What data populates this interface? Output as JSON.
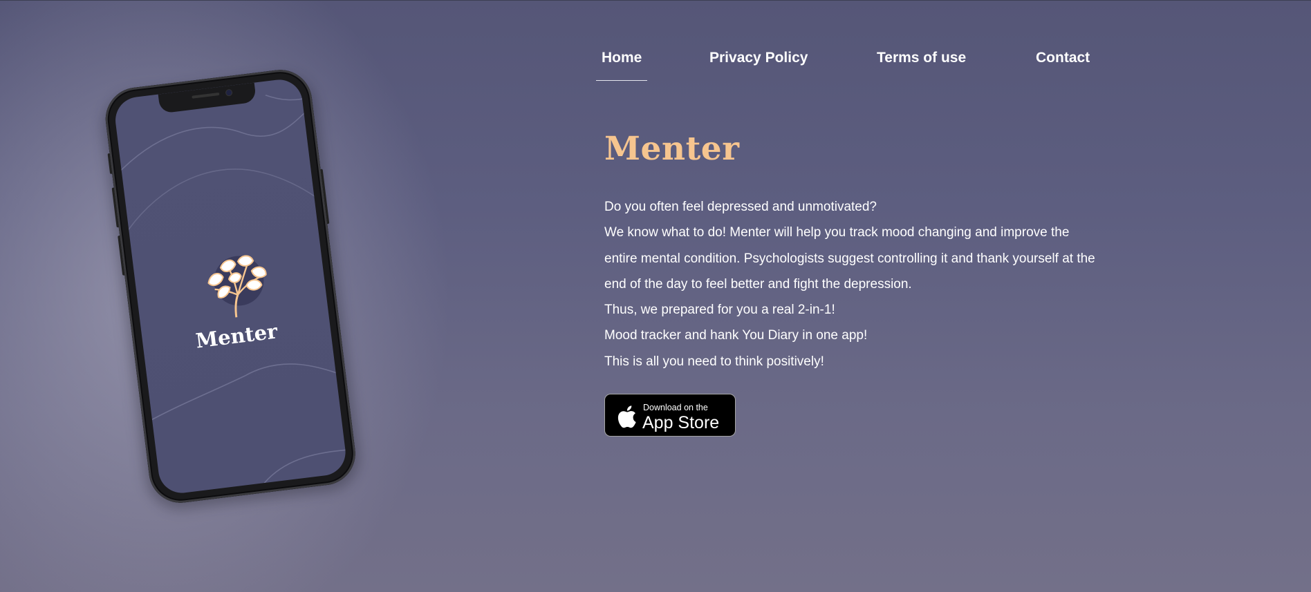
{
  "nav": {
    "items": [
      {
        "label": "Home",
        "active": true
      },
      {
        "label": "Privacy Policy",
        "active": false
      },
      {
        "label": "Terms of use",
        "active": false
      },
      {
        "label": "Contact",
        "active": false
      }
    ]
  },
  "hero": {
    "title": "Menter",
    "lines": [
      "Do you often feel depressed and unmotivated?",
      "We know what to do! Menter will help you track mood changing and improve the entire mental condition. Psychologists suggest controlling it and thank yourself at the end of the day to feel better and fight the depression.",
      "Thus, we prepared for you a real 2-in-1!",
      "Mood tracker and hank You Diary in one app!",
      "This is all you need to think positively!"
    ]
  },
  "appstore": {
    "small_label": "Download on the",
    "big_label": "App Store",
    "icon": "apple-icon"
  },
  "phone": {
    "app_name": "Menter",
    "logo_icon": "brain-leaves-icon"
  },
  "colors": {
    "title": "#f6c58f",
    "background_top": "#555677",
    "background_bottom": "#737089",
    "screen": "#4f5173",
    "text": "#ffffff"
  }
}
